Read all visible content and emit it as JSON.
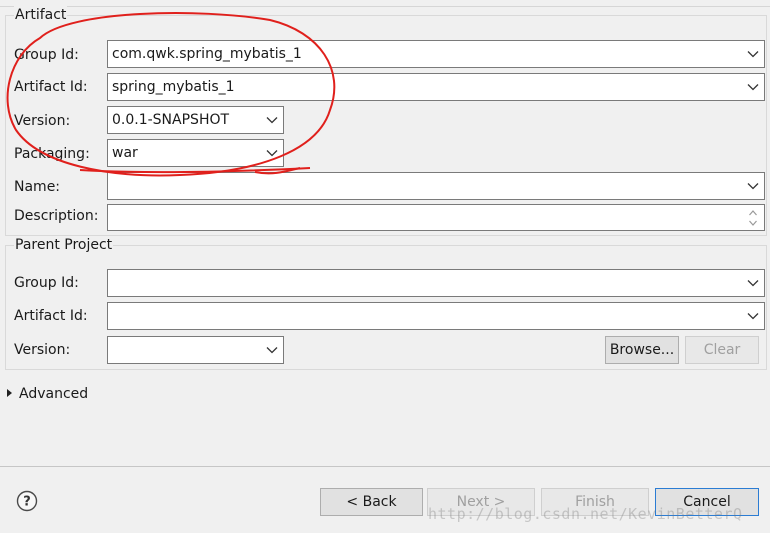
{
  "artifact": {
    "legend": "Artifact",
    "group_id": {
      "label": "Group Id:",
      "value": "com.qwk.spring_mybatis_1"
    },
    "artifact_id": {
      "label": "Artifact Id:",
      "value": "spring_mybatis_1"
    },
    "version": {
      "label": "Version:",
      "value": "0.0.1-SNAPSHOT"
    },
    "packaging": {
      "label": "Packaging:",
      "value": "war"
    },
    "name": {
      "label": "Name:",
      "value": ""
    },
    "description": {
      "label": "Description:",
      "value": ""
    }
  },
  "parent": {
    "legend": "Parent Project",
    "group_id": {
      "label": "Group Id:",
      "value": ""
    },
    "artifact_id": {
      "label": "Artifact Id:",
      "value": ""
    },
    "version": {
      "label": "Version:",
      "value": ""
    },
    "browse_label": "Browse...",
    "clear_label": "Clear"
  },
  "advanced_label": "Advanced",
  "footer": {
    "help_icon": "question-circle-icon",
    "back_label": "< Back",
    "next_label": "Next >",
    "finish_label": "Finish",
    "cancel_label": "Cancel"
  },
  "watermark": "http://blog.csdn.net/KevinBetterQ",
  "colors": {
    "annotation": "#e0201c",
    "focus_border": "#2b7cd3"
  }
}
